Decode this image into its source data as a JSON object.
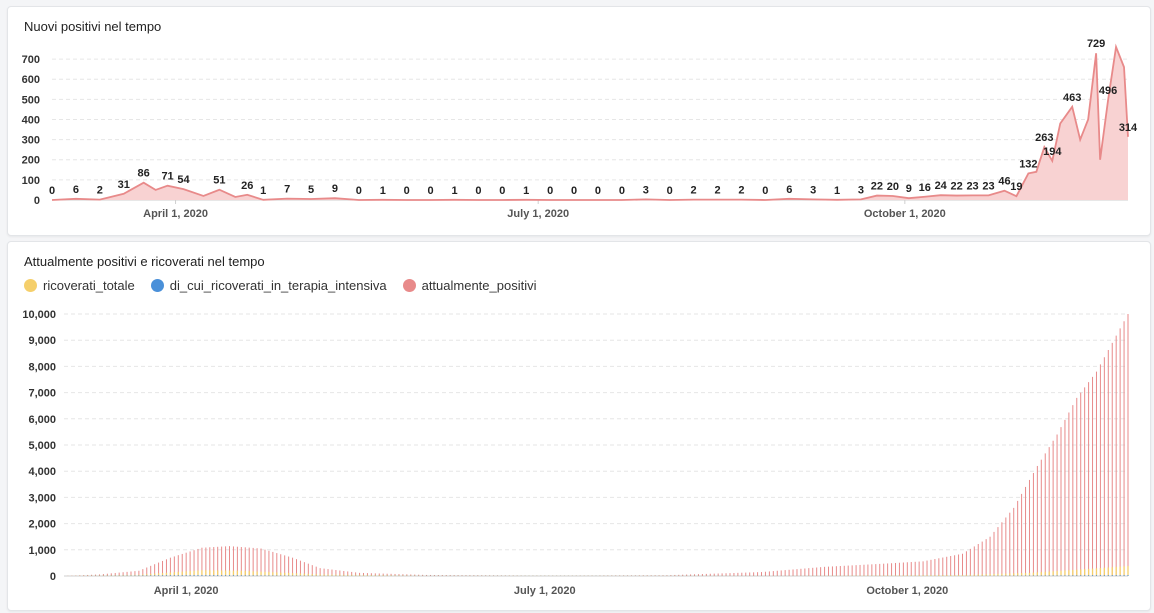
{
  "colors": {
    "red": "#e88a8a",
    "redFill": "#f8d2d2",
    "yellow": "#f5cf6b",
    "blue": "#4a90d9",
    "grid": "#e6e6e6"
  },
  "chart_data": [
    {
      "type": "area",
      "title": "Nuovi positivi nel tempo",
      "ylim": [
        0,
        760
      ],
      "yticks": [
        0,
        100,
        200,
        300,
        400,
        500,
        600,
        700
      ],
      "xrange": [
        "2020-03-01",
        "2020-11-01"
      ],
      "xticks": [
        {
          "date": "2020-04-01",
          "label": "April 1, 2020"
        },
        {
          "date": "2020-07-01",
          "label": "July 1, 2020"
        },
        {
          "date": "2020-10-01",
          "label": "October 1, 2020"
        }
      ],
      "series": [
        {
          "points": [
            [
              "2020-03-01",
              0
            ],
            [
              "2020-03-07",
              6
            ],
            [
              "2020-03-13",
              2
            ],
            [
              "2020-03-19",
              31
            ],
            [
              "2020-03-24",
              86
            ],
            [
              "2020-03-27",
              50
            ],
            [
              "2020-03-30",
              71
            ],
            [
              "2020-04-03",
              54
            ],
            [
              "2020-04-08",
              20
            ],
            [
              "2020-04-12",
              51
            ],
            [
              "2020-04-16",
              15
            ],
            [
              "2020-04-19",
              26
            ],
            [
              "2020-04-23",
              1
            ],
            [
              "2020-04-29",
              7
            ],
            [
              "2020-05-05",
              5
            ],
            [
              "2020-05-11",
              9
            ],
            [
              "2020-05-17",
              0
            ],
            [
              "2020-05-23",
              1
            ],
            [
              "2020-05-29",
              0
            ],
            [
              "2020-06-04",
              0
            ],
            [
              "2020-06-10",
              1
            ],
            [
              "2020-06-16",
              0
            ],
            [
              "2020-06-22",
              0
            ],
            [
              "2020-06-28",
              1
            ],
            [
              "2020-07-04",
              0
            ],
            [
              "2020-07-10",
              0
            ],
            [
              "2020-07-16",
              0
            ],
            [
              "2020-07-22",
              0
            ],
            [
              "2020-07-28",
              3
            ],
            [
              "2020-08-03",
              0
            ],
            [
              "2020-08-09",
              2
            ],
            [
              "2020-08-15",
              2
            ],
            [
              "2020-08-21",
              2
            ],
            [
              "2020-08-27",
              0
            ],
            [
              "2020-09-02",
              6
            ],
            [
              "2020-09-08",
              3
            ],
            [
              "2020-09-14",
              1
            ],
            [
              "2020-09-20",
              3
            ],
            [
              "2020-09-24",
              22
            ],
            [
              "2020-09-28",
              20
            ],
            [
              "2020-10-02",
              9
            ],
            [
              "2020-10-06",
              16
            ],
            [
              "2020-10-10",
              24
            ],
            [
              "2020-10-14",
              22
            ],
            [
              "2020-10-18",
              23
            ],
            [
              "2020-10-22",
              23
            ],
            [
              "2020-10-26",
              46
            ],
            [
              "2020-10-29",
              19
            ],
            [
              "2020-11-01",
              132
            ],
            [
              "2020-11-03",
              140
            ],
            [
              "2020-11-05",
              263
            ],
            [
              "2020-11-07",
              194
            ],
            [
              "2020-11-09",
              380
            ],
            [
              "2020-11-12",
              463
            ],
            [
              "2020-11-14",
              300
            ],
            [
              "2020-11-16",
              400
            ],
            [
              "2020-11-18",
              729
            ],
            [
              "2020-11-19",
              200
            ],
            [
              "2020-11-21",
              496
            ],
            [
              "2020-11-23",
              760
            ],
            [
              "2020-11-25",
              660
            ],
            [
              "2020-11-26",
              314
            ]
          ]
        }
      ],
      "labels": [
        [
          "2020-03-01",
          "0"
        ],
        [
          "2020-03-07",
          "6"
        ],
        [
          "2020-03-13",
          "2"
        ],
        [
          "2020-03-19",
          "31"
        ],
        [
          "2020-03-24",
          "86"
        ],
        [
          "2020-03-30",
          "71"
        ],
        [
          "2020-04-03",
          "54"
        ],
        [
          "2020-04-12",
          "51"
        ],
        [
          "2020-04-19",
          "26"
        ],
        [
          "2020-04-23",
          "1"
        ],
        [
          "2020-04-29",
          "7"
        ],
        [
          "2020-05-05",
          "5"
        ],
        [
          "2020-05-11",
          "9"
        ],
        [
          "2020-05-17",
          "0"
        ],
        [
          "2020-05-23",
          "1"
        ],
        [
          "2020-05-29",
          "0"
        ],
        [
          "2020-06-04",
          "0"
        ],
        [
          "2020-06-10",
          "1"
        ],
        [
          "2020-06-16",
          "0"
        ],
        [
          "2020-06-22",
          "0"
        ],
        [
          "2020-06-28",
          "1"
        ],
        [
          "2020-07-04",
          "0"
        ],
        [
          "2020-07-10",
          "0"
        ],
        [
          "2020-07-16",
          "0"
        ],
        [
          "2020-07-22",
          "0"
        ],
        [
          "2020-07-28",
          "3"
        ],
        [
          "2020-08-03",
          "0"
        ],
        [
          "2020-08-09",
          "2"
        ],
        [
          "2020-08-15",
          "2"
        ],
        [
          "2020-08-21",
          "2"
        ],
        [
          "2020-08-27",
          "0"
        ],
        [
          "2020-09-02",
          "6"
        ],
        [
          "2020-09-08",
          "3"
        ],
        [
          "2020-09-14",
          "1"
        ],
        [
          "2020-09-20",
          "3"
        ],
        [
          "2020-09-24",
          "22"
        ],
        [
          "2020-09-28",
          "20"
        ],
        [
          "2020-10-02",
          "9"
        ],
        [
          "2020-10-06",
          "16"
        ],
        [
          "2020-10-10",
          "24"
        ],
        [
          "2020-10-14",
          "22"
        ],
        [
          "2020-10-18",
          "23"
        ],
        [
          "2020-10-22",
          "23"
        ],
        [
          "2020-10-26",
          "46"
        ],
        [
          "2020-10-29",
          "19"
        ],
        [
          "2020-11-01",
          "132"
        ],
        [
          "2020-11-05",
          "263"
        ],
        [
          "2020-11-07",
          "194"
        ],
        [
          "2020-11-12",
          "463"
        ],
        [
          "2020-11-18",
          "729"
        ],
        [
          "2020-11-21",
          "496"
        ],
        [
          "2020-11-26",
          "314"
        ]
      ]
    },
    {
      "type": "bar",
      "title": "Attualmente positivi e ricoverati nel tempo",
      "ylim": [
        0,
        10000
      ],
      "yticks": [
        {
          "v": 0,
          "label": "0"
        },
        {
          "v": 1000,
          "label": "1,000"
        },
        {
          "v": 2000,
          "label": "2,000"
        },
        {
          "v": 3000,
          "label": "3,000"
        },
        {
          "v": 4000,
          "label": "4,000"
        },
        {
          "v": 5000,
          "label": "5,000"
        },
        {
          "v": 6000,
          "label": "6,000"
        },
        {
          "v": 7000,
          "label": "7,000"
        },
        {
          "v": 8000,
          "label": "8,000"
        },
        {
          "v": 9000,
          "label": "9,000"
        },
        {
          "v": 10000,
          "label": "10,000"
        }
      ],
      "xrange": [
        "2020-03-01",
        "2020-11-26"
      ],
      "xticks": [
        {
          "date": "2020-04-01",
          "label": "April 1, 2020"
        },
        {
          "date": "2020-07-01",
          "label": "July 1, 2020"
        },
        {
          "date": "2020-10-01",
          "label": "October 1, 2020"
        }
      ],
      "legend": [
        {
          "name": "ricoverati_totale",
          "color": "#f5cf6b"
        },
        {
          "name": "di_cui_ricoverati_in_terapia_intensiva",
          "color": "#4a90d9"
        },
        {
          "name": "attualmente_positivi",
          "color": "#e88a8a"
        }
      ],
      "series": [
        {
          "name": "attualmente_positivi",
          "points": [
            [
              "2020-03-01",
              0
            ],
            [
              "2020-03-10",
              60
            ],
            [
              "2020-03-20",
              200
            ],
            [
              "2020-03-28",
              700
            ],
            [
              "2020-04-05",
              1080
            ],
            [
              "2020-04-12",
              1140
            ],
            [
              "2020-04-20",
              1050
            ],
            [
              "2020-04-28",
              700
            ],
            [
              "2020-05-05",
              300
            ],
            [
              "2020-05-15",
              120
            ],
            [
              "2020-06-01",
              40
            ],
            [
              "2020-07-01",
              15
            ],
            [
              "2020-08-01",
              30
            ],
            [
              "2020-08-25",
              150
            ],
            [
              "2020-09-10",
              350
            ],
            [
              "2020-09-25",
              470
            ],
            [
              "2020-10-05",
              560
            ],
            [
              "2020-10-15",
              850
            ],
            [
              "2020-10-22",
              1500
            ],
            [
              "2020-10-28",
              2600
            ],
            [
              "2020-11-03",
              4200
            ],
            [
              "2020-11-08",
              5400
            ],
            [
              "2020-11-13",
              6800
            ],
            [
              "2020-11-18",
              7800
            ],
            [
              "2020-11-22",
              8900
            ],
            [
              "2020-11-26",
              10000
            ]
          ]
        },
        {
          "name": "ricoverati_totale",
          "points": [
            [
              "2020-03-01",
              0
            ],
            [
              "2020-03-20",
              50
            ],
            [
              "2020-04-05",
              220
            ],
            [
              "2020-04-15",
              200
            ],
            [
              "2020-05-05",
              60
            ],
            [
              "2020-06-01",
              15
            ],
            [
              "2020-09-01",
              10
            ],
            [
              "2020-10-15",
              40
            ],
            [
              "2020-11-01",
              120
            ],
            [
              "2020-11-15",
              260
            ],
            [
              "2020-11-26",
              380
            ]
          ]
        },
        {
          "name": "di_cui_ricoverati_in_terapia_intensiva",
          "points": [
            [
              "2020-03-01",
              0
            ],
            [
              "2020-04-05",
              40
            ],
            [
              "2020-05-05",
              10
            ],
            [
              "2020-10-15",
              5
            ],
            [
              "2020-11-26",
              40
            ]
          ]
        }
      ]
    }
  ]
}
